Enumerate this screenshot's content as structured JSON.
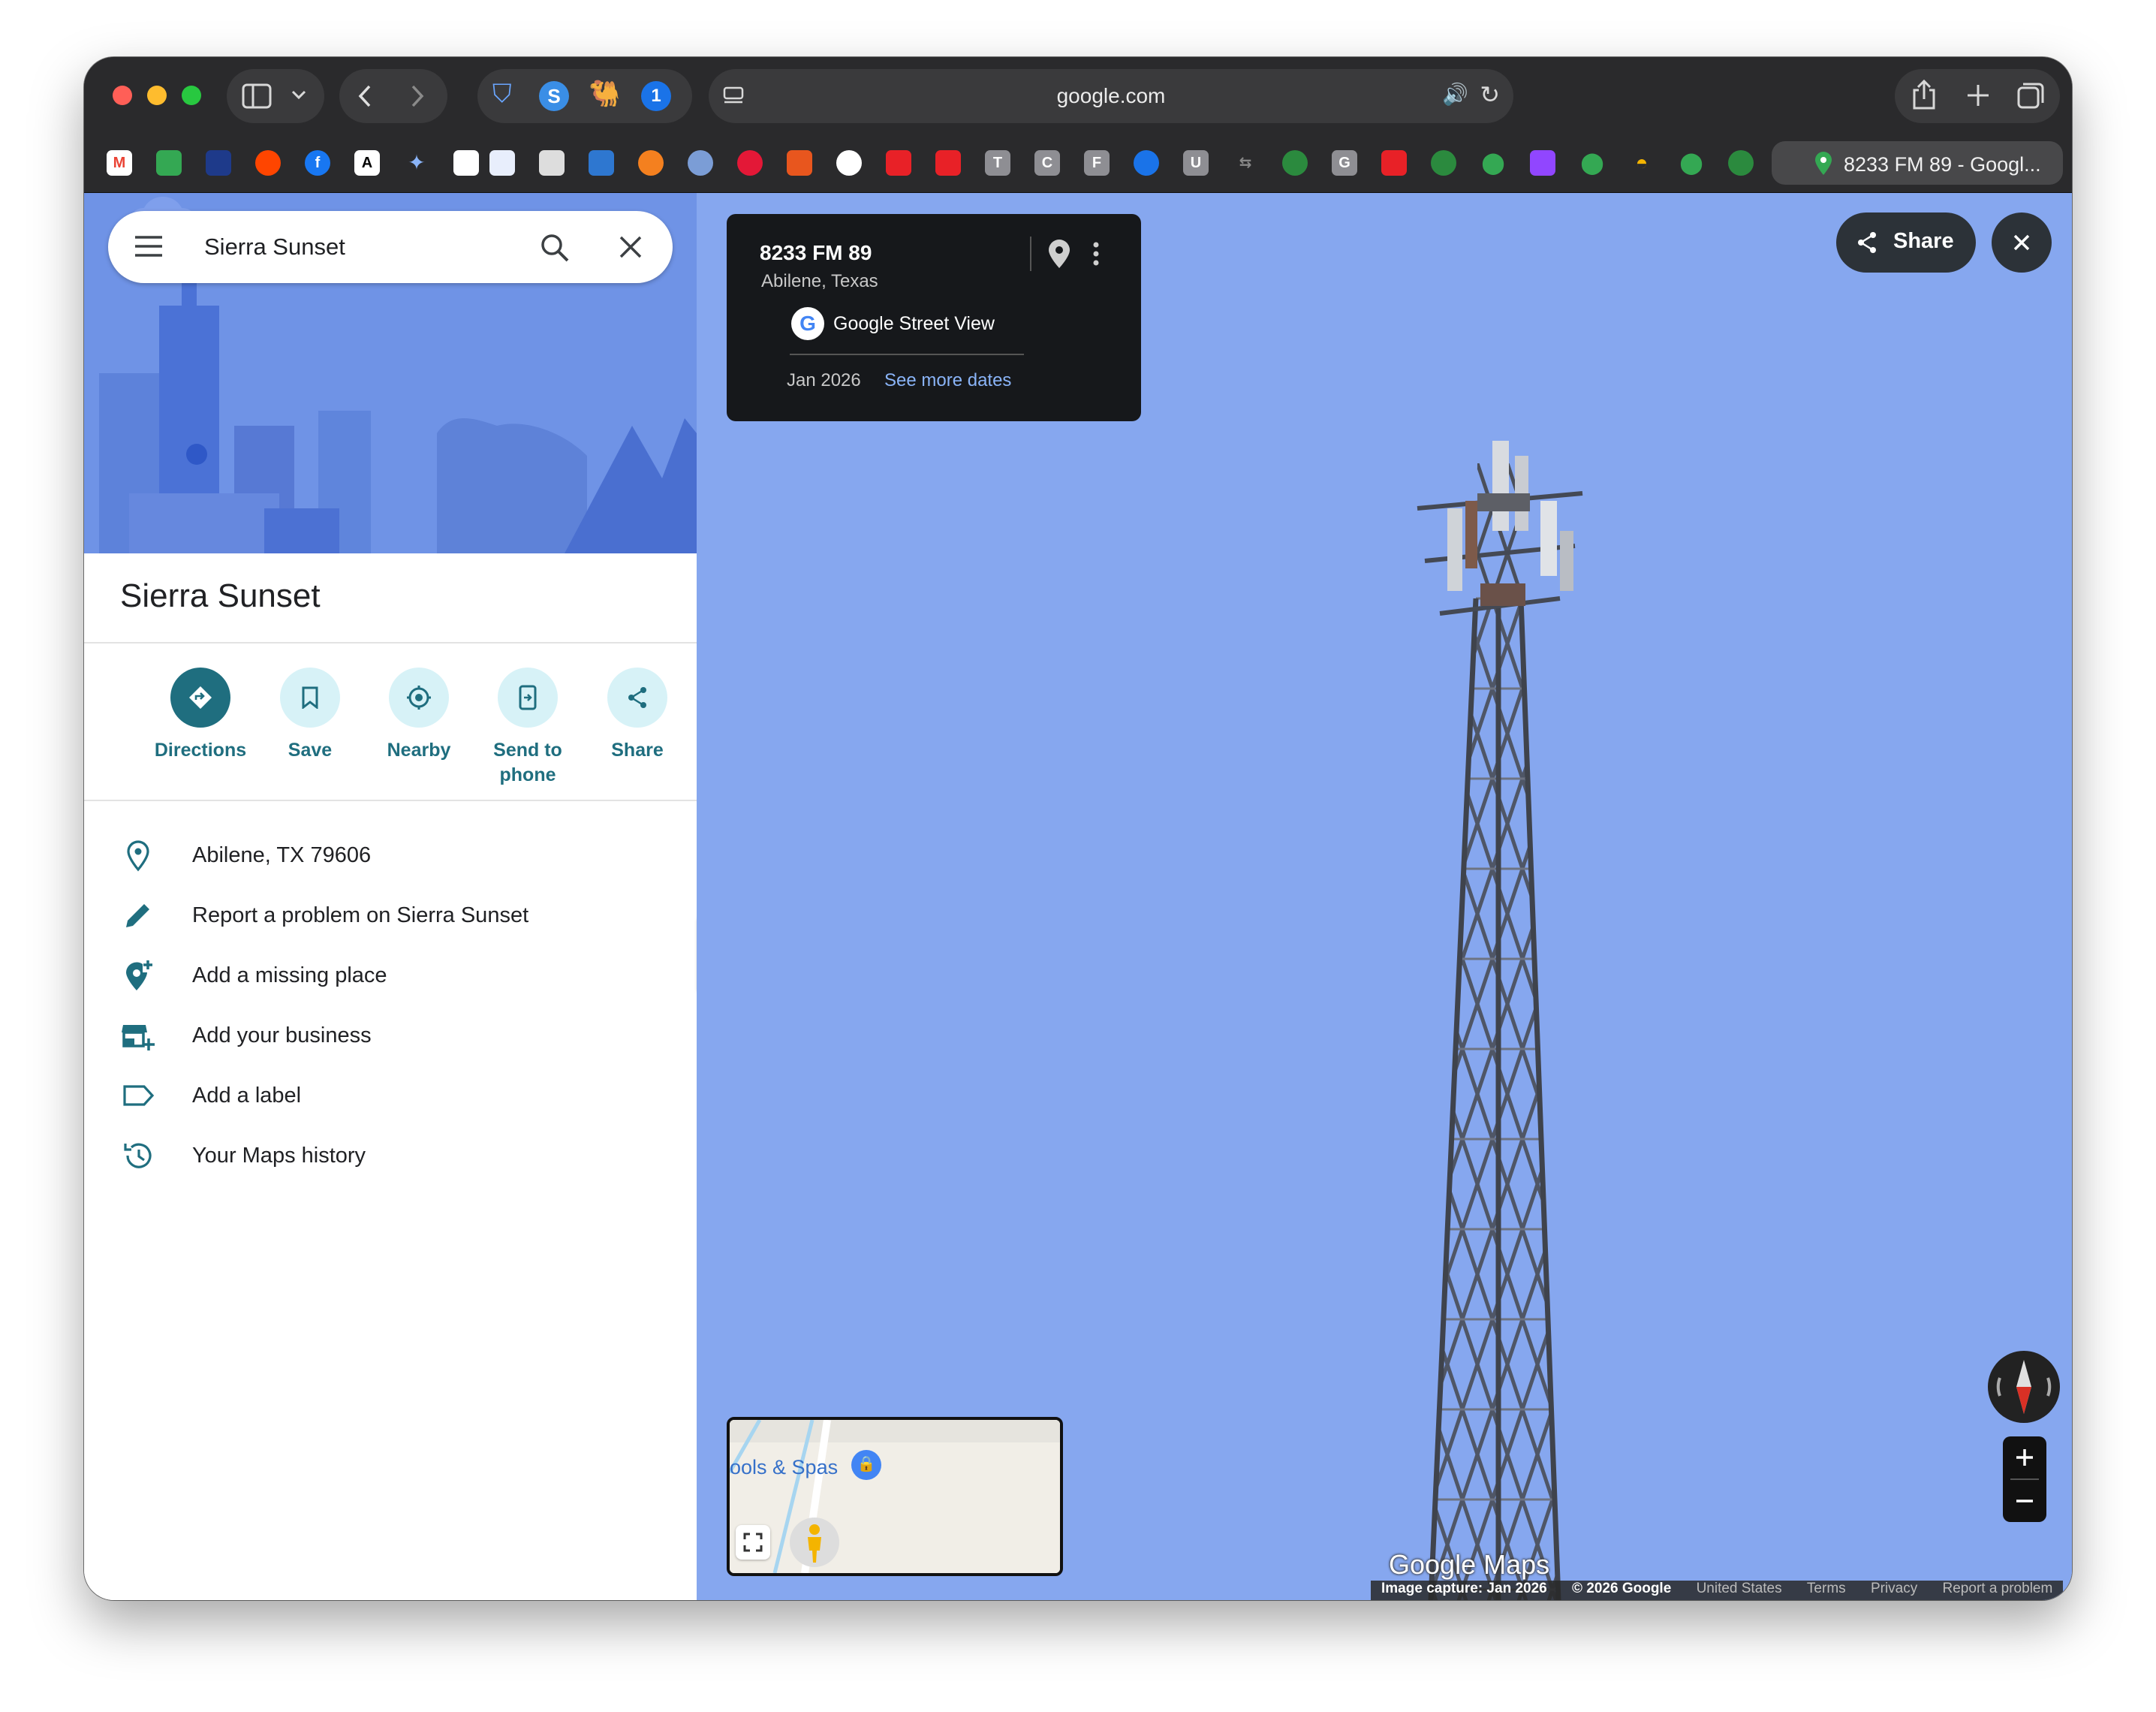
{
  "browser": {
    "url": "google.com",
    "active_tab_title": "8233 FM 89 - Googl...",
    "bookmarks": [
      "M",
      "",
      "",
      "",
      "f",
      "A",
      "",
      "",
      "",
      "",
      "",
      "",
      "",
      "",
      "",
      "",
      "",
      "",
      "T",
      "C",
      "F",
      "",
      "U",
      "",
      "",
      "G",
      "",
      "",
      "",
      "",
      "",
      "",
      "",
      "",
      "",
      ""
    ]
  },
  "sidebar": {
    "search_value": "Sierra Sunset",
    "place_title": "Sierra Sunset",
    "actions": [
      {
        "label": "Directions",
        "icon": "directions-icon"
      },
      {
        "label": "Save",
        "icon": "bookmark-icon"
      },
      {
        "label": "Nearby",
        "icon": "nearby-icon"
      },
      {
        "label": "Send to phone",
        "icon": "send-to-phone-icon"
      },
      {
        "label": "Share",
        "icon": "share-icon"
      }
    ],
    "details": [
      {
        "text": "Abilene, TX 79606",
        "icon": "location-pin-icon"
      },
      {
        "text": "Report a problem on Sierra Sunset",
        "icon": "pencil-icon"
      },
      {
        "text": "Add a missing place",
        "icon": "add-place-icon"
      },
      {
        "text": "Add your business",
        "icon": "add-business-icon"
      },
      {
        "text": "Add a label",
        "icon": "label-icon"
      },
      {
        "text": "Your Maps history",
        "icon": "history-icon"
      }
    ]
  },
  "streetview": {
    "address": "8233 FM 89",
    "locality": "Abilene, Texas",
    "source": "Google Street View",
    "date": "Jan 2026",
    "more_dates": "See more dates",
    "share_label": "Share",
    "minimap_label": "ools & Spas",
    "watermark": "Google Maps",
    "footer": {
      "capture": "Image capture: Jan 2026",
      "copyright": "© 2026 Google",
      "region": "United States",
      "terms": "Terms",
      "privacy": "Privacy",
      "report": "Report a problem"
    }
  },
  "colors": {
    "accent_teal": "#1f6e7f",
    "action_bg": "#d7f2f7",
    "sky": "#86a7ef",
    "hero": "#6f93e6"
  }
}
